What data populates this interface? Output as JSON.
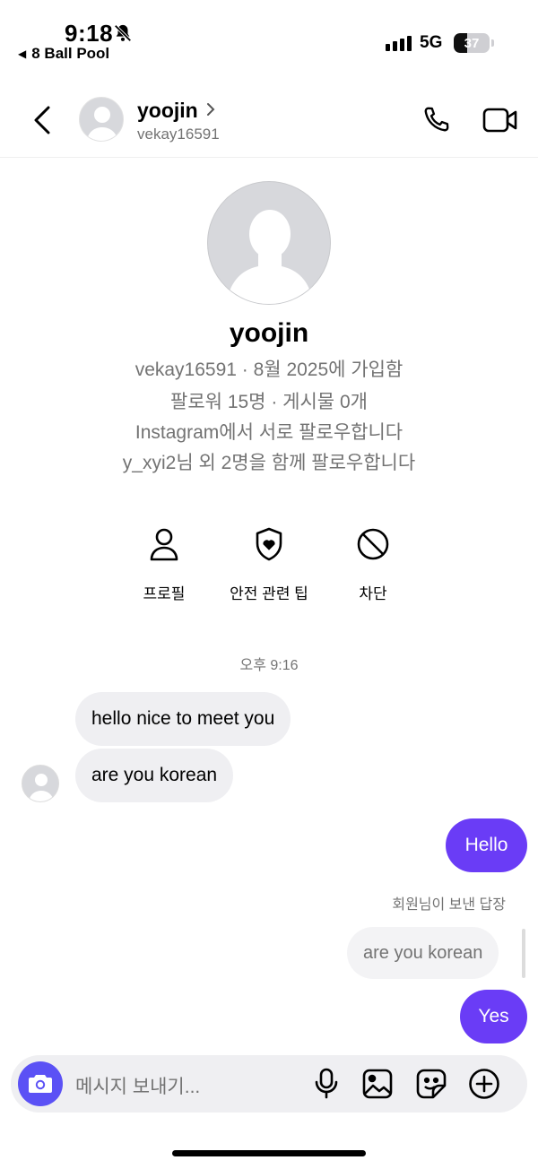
{
  "status_bar": {
    "time": "9:18",
    "back_app": "8 Ball Pool",
    "network": "5G",
    "battery": "37",
    "battery_level": 0.37
  },
  "header": {
    "name": "yoojin",
    "username": "vekay16591"
  },
  "profile": {
    "name": "yoojin",
    "line1": "vekay16591 · 8월 2025에 가입함",
    "line2": "팔로워 15명 · 게시물 0개",
    "line3": "Instagram에서 서로 팔로우합니다",
    "line4": "y_xyi2님 외 2명을 함께 팔로우합니다"
  },
  "actions": {
    "profile": "프로필",
    "safety": "안전 관련 팁",
    "block": "차단"
  },
  "thread": {
    "timestamp": "오후 9:16",
    "messages": [
      {
        "from": "them",
        "text": "hello nice to meet you"
      },
      {
        "from": "them",
        "text": "are you korean"
      },
      {
        "from": "me",
        "text": "Hello"
      },
      {
        "from": "me",
        "text": "Yes",
        "reply_note": "회원님이 보낸 답장",
        "quoted": "are you korean"
      }
    ]
  },
  "composer": {
    "placeholder": "메시지 보내기..."
  },
  "colors": {
    "accent": "#6a3cf6",
    "camera": "#5b51f5",
    "incoming_bubble": "#efeff2",
    "secondary_text": "#737373"
  }
}
